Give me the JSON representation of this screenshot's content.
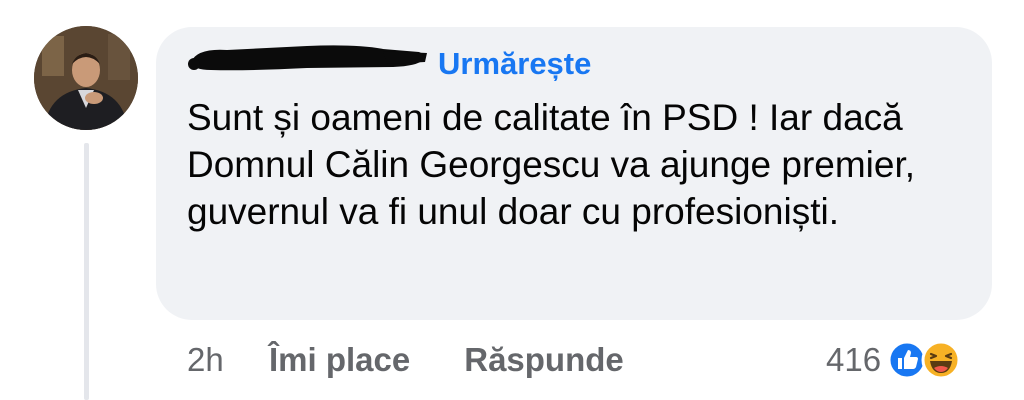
{
  "comment": {
    "follow_label": "Urmărește",
    "text": "Sunt și oameni de calitate în PSD ! Iar dacă Domnul Călin Georgescu va ajunge premier, guvernul va fi unul doar cu profesioniști."
  },
  "actions": {
    "time": "2h",
    "like_label": "Îmi place",
    "reply_label": "Răspunde"
  },
  "reactions": {
    "count": "416",
    "icons": [
      "like-icon",
      "haha-icon"
    ]
  },
  "colors": {
    "link": "#1877f2",
    "bubble": "#f0f2f5",
    "meta_text": "#65676b",
    "body_text": "#050505"
  }
}
